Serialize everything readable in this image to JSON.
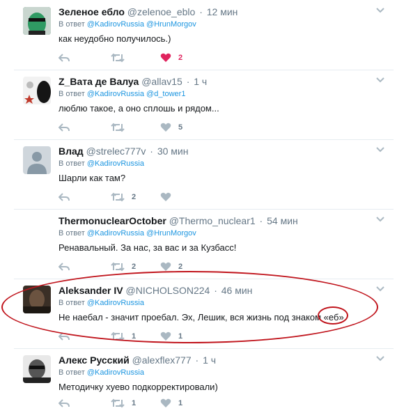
{
  "tweets": [
    {
      "name": "Зеленое ебло",
      "handle": "@zelenoe_eblo",
      "time": "12 мин",
      "reply_prefix": "В ответ",
      "mentions": "@KadirovRussia @HrunMorgov",
      "text": "как неудобно получилось.)",
      "retweets": "",
      "likes": "2",
      "liked": true
    },
    {
      "name": "Z_Вата де Валуа",
      "handle": "@allav15",
      "time": "1 ч",
      "reply_prefix": "В ответ",
      "mentions": "@KadirovRussia @d_tower1",
      "text": "люблю такое, а оно сплошь и рядом...",
      "retweets": "",
      "likes": "5",
      "liked": false
    },
    {
      "name": "Влад",
      "handle": "@strelec777v",
      "time": "30 мин",
      "reply_prefix": "В ответ",
      "mentions": "@KadirovRussia",
      "text": "Шарли как там?",
      "retweets": "2",
      "likes": "",
      "liked": false
    },
    {
      "name": "ThermonuclearOctober",
      "handle": "@Thermo_nuclear1",
      "time": "54 мин",
      "reply_prefix": "В ответ",
      "mentions": "@KadirovRussia @HrunMorgov",
      "text": "Ренавальный. За нас, за вас и за Кузбасс!",
      "retweets": "2",
      "likes": "2",
      "liked": false
    },
    {
      "name": "Aleksander IV",
      "handle": "@NICHOLSON224",
      "time": "46 мин",
      "reply_prefix": "В ответ",
      "mentions": "@KadirovRussia",
      "text": "Не наебал - значит проебал. Эх, Лешик, вся жизнь под знаком «еб».",
      "retweets": "1",
      "likes": "1",
      "liked": false
    },
    {
      "name": "Алекс Русский",
      "handle": "@alexflex777",
      "time": "1 ч",
      "reply_prefix": "В ответ",
      "mentions": "@KadirovRussia",
      "text": "Методичку хуево подкорректировали)",
      "retweets": "1",
      "likes": "1",
      "liked": false
    }
  ],
  "separator": "·",
  "colors": {
    "link": "#1b95e0",
    "muted": "#657786",
    "like_active": "#e0245e",
    "annotation": "#c0141c"
  },
  "icons": [
    "reply-icon",
    "retweet-icon",
    "heart-icon",
    "chevron-down-icon"
  ]
}
